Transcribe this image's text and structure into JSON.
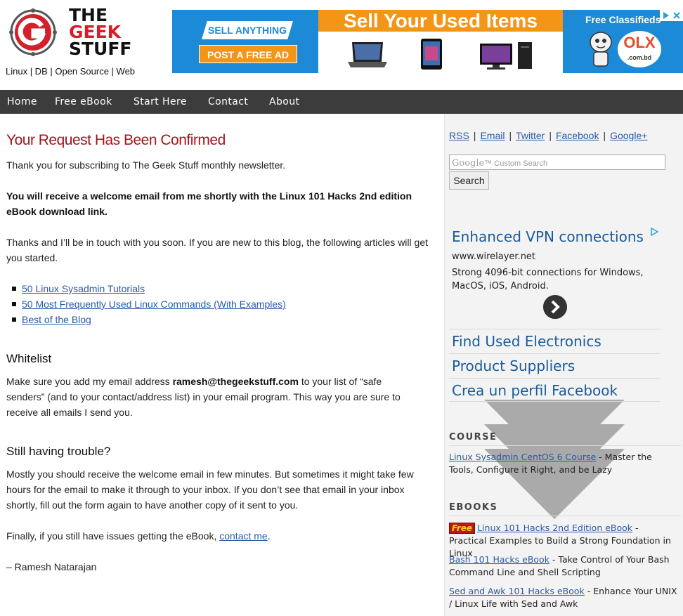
{
  "header": {
    "logo_line1": "THE",
    "logo_line2": "GEEK",
    "logo_line3": "STUFF",
    "tagline": "Linux | DB | Open Source | Web"
  },
  "ad_banner": {
    "sell_anything": "SELL ANYTHING",
    "post_free_ad": "POST A FREE AD",
    "headline": "Sell Your Used Items",
    "free_classifieds": "Free Classifieds",
    "olx": "OLX",
    "olx_domain": ".com.bd",
    "colors": {
      "blue": "#1c8ad6",
      "orange": "#f39517"
    }
  },
  "nav": {
    "items": [
      "Home",
      "Free eBook",
      "Start Here",
      "Contact",
      "About"
    ]
  },
  "main": {
    "title": "Your Request Has Been Confirmed",
    "p1": "Thank you for subscribing to The Geek Stuff monthly newsletter.",
    "p2": "You will receive a welcome email from me shortly with the Linux 101 Hacks 2nd edition eBook download link.",
    "p3": "Thanks and I’ll be in touch with you soon. If you are new to this blog, the following articles will get you started.",
    "articles": [
      "50 Linux Sysadmin Tutorials",
      "50 Most Frequently Used Linux Commands (With Examples)",
      "Best of the Blog"
    ],
    "whitelist_heading": "Whitelist",
    "whitelist_pre": "Make sure you add my email address ",
    "whitelist_email": "ramesh@thegeekstuff.com",
    "whitelist_post": " to your list of “safe senders” (and to your contact/address list) in your email program. This way you are sure to receive all emails I send you.",
    "trouble_heading": "Still having trouble?",
    "trouble_p": "Mostly you should receive the welcome email in few minutes. But sometimes it might take few hours for the email to make it through to your inbox. If you don’t see that email in your inbox shortly, fill out the form again to have another copy of it sent to you.",
    "finally_pre": "Finally, if you still have issues getting the eBook, ",
    "finally_link": "contact me",
    "finally_post": ".",
    "signature": "– Ramesh Natarajan"
  },
  "sidebar": {
    "social": [
      "RSS",
      "Email",
      "Twitter",
      "Facebook",
      "Google+"
    ],
    "search_watermark_brand": "Google",
    "search_watermark_text": "Custom Search",
    "search_button": "Search",
    "ad": {
      "title": "Enhanced VPN connections",
      "url": "www.wirelayer.net",
      "desc": "Strong 4096-bit connections for Windows, MacOS, iOS, Android.",
      "links": [
        "Find Used Electronics",
        "Product Suppliers",
        "Crea un perfil Facebook"
      ]
    },
    "course_heading": "COURSE",
    "course_link": "Linux Sysadmin CentOS 6 Course",
    "course_text": " - Master the Tools, Configure it Right, and be Lazy",
    "ebooks_heading": "EBOOKS",
    "free_badge": "Free",
    "ebooks": [
      {
        "link": "Linux 101 Hacks 2nd Edition eBook",
        "text": " - Practical Examples to Build a Strong Foundation in Linux"
      },
      {
        "link": "Bash 101 Hacks eBook",
        "text": " - Take Control of Your Bash Command Line and Shell Scripting"
      },
      {
        "link": "Sed and Awk 101 Hacks eBook",
        "text": " - Enhance Your UNIX / Linux Life with Sed and Awk"
      }
    ]
  }
}
